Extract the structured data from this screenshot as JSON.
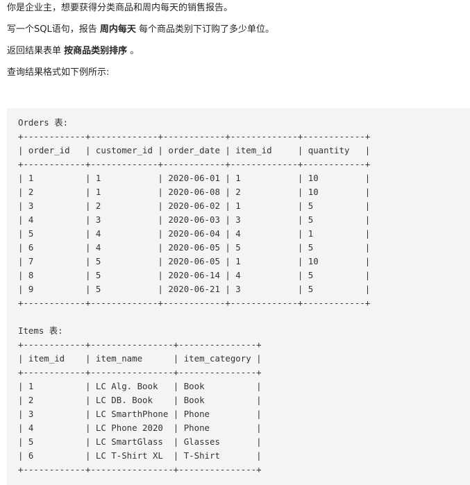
{
  "intro": {
    "line1": "你是企业主，想要获得分类商品和周内每天的销售报告。",
    "line2": {
      "before": "写一个SQL语句，报告 ",
      "bold": "周内每天",
      "after": " 每个商品类别下订购了多少单位。"
    },
    "line3": {
      "before": "返回结果表单 ",
      "bold": "按商品类别排序",
      "after": " 。"
    },
    "line4": "查询结果格式如下例所示:"
  },
  "orders_table": {
    "title": "Orders 表:",
    "border": "+------------+-------------+------------+-------------+------------+",
    "header": "| order_id   | customer_id | order_date | item_id     | quantity   |",
    "rows": [
      "| 1          | 1           | 2020-06-01 | 1           | 10         |",
      "| 2          | 1           | 2020-06-08 | 2           | 10         |",
      "| 3          | 2           | 2020-06-02 | 1           | 5          |",
      "| 4          | 3           | 2020-06-03 | 3           | 5          |",
      "| 5          | 4           | 2020-06-04 | 4           | 1          |",
      "| 6          | 4           | 2020-06-05 | 5           | 5          |",
      "| 7          | 5           | 2020-06-05 | 1           | 10         |",
      "| 8          | 5           | 2020-06-14 | 4           | 5          |",
      "| 9          | 5           | 2020-06-21 | 3           | 5          |"
    ]
  },
  "items_table": {
    "title": "Items 表:",
    "border": "+------------+----------------+---------------+",
    "header": "| item_id    | item_name      | item_category |",
    "rows": [
      "| 1          | LC Alg. Book   | Book          |",
      "| 2          | LC DB. Book    | Book          |",
      "| 3          | LC SmarthPhone | Phone         |",
      "| 4          | LC Phone 2020  | Phone         |",
      "| 5          | LC SmartGlass  | Glasses       |",
      "| 6          | LC T-Shirt XL  | T-Shirt       |"
    ]
  }
}
